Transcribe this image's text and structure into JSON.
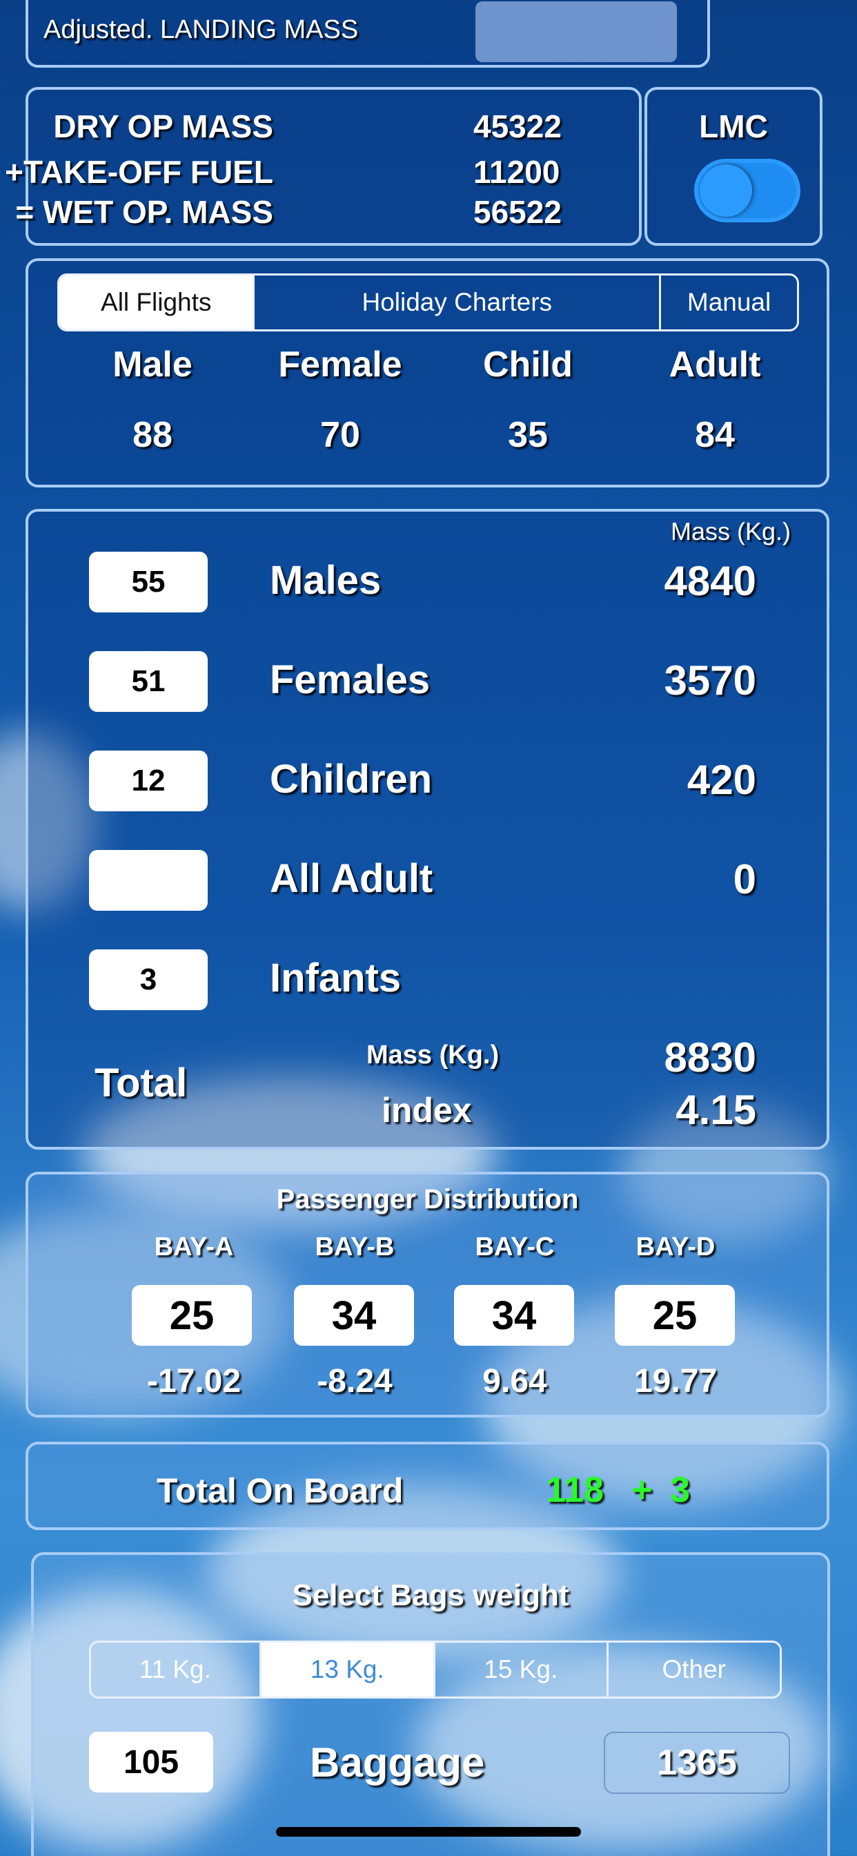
{
  "landing": {
    "label": "Adjusted. LANDING MASS"
  },
  "mass": {
    "dry_label": "DRY OP MASS",
    "dry_value": "45322",
    "fuel_label": "+TAKE-OFF FUEL",
    "fuel_value": "11200",
    "wet_label": "= WET OP. MASS",
    "wet_value": "56522"
  },
  "lmc": {
    "label": "LMC",
    "toggle_on": true
  },
  "standard_mass": {
    "tabs": [
      "All Flights",
      "Holiday Charters",
      "Manual"
    ],
    "selected_tab": "All Flights",
    "headers": [
      "Male",
      "Female",
      "Child",
      "Adult"
    ],
    "values": [
      "88",
      "70",
      "35",
      "84"
    ]
  },
  "passengers": {
    "unit_label": "Mass (Kg.)",
    "rows": [
      {
        "count": "55",
        "label": "Males",
        "mass": "4840"
      },
      {
        "count": "51",
        "label": "Females",
        "mass": "3570"
      },
      {
        "count": "12",
        "label": "Children",
        "mass": "420"
      },
      {
        "count": "",
        "label": "All Adult",
        "mass": "0"
      },
      {
        "count": "3",
        "label": "Infants",
        "mass": ""
      }
    ],
    "total_label": "Total",
    "total_mass_label": "Mass (Kg.)",
    "total_mass": "8830",
    "index_label": "index",
    "index_value": "4.15"
  },
  "distribution": {
    "title": "Passenger Distribution",
    "bays": [
      {
        "name": "BAY-A",
        "count": "25",
        "index": "-17.02"
      },
      {
        "name": "BAY-B",
        "count": "34",
        "index": "-8.24"
      },
      {
        "name": "BAY-C",
        "count": "34",
        "index": "9.64"
      },
      {
        "name": "BAY-D",
        "count": "25",
        "index": "19.77"
      }
    ]
  },
  "onboard": {
    "label": "Total On Board",
    "adults": "118",
    "plus": "+",
    "infants": "3",
    "accent": "#2bf82b"
  },
  "bags": {
    "title": "Select Bags weight",
    "options": [
      "11 Kg.",
      "13 Kg.",
      "15 Kg.",
      "Other"
    ],
    "selected": "13 Kg.",
    "count": "105",
    "label": "Baggage",
    "mass": "1365"
  }
}
